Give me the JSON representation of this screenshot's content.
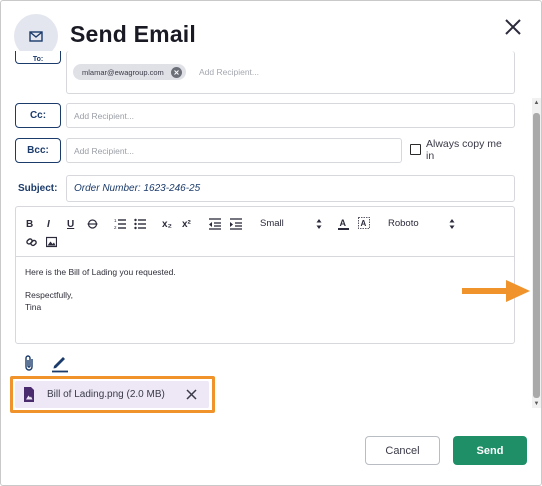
{
  "header": {
    "title": "Send Email",
    "icon": "mail-icon",
    "close_icon": "close-icon"
  },
  "to": {
    "label": "To:",
    "chips": [
      {
        "email": "mlamar@ewagroup.com"
      }
    ],
    "placeholder": "Add Recipient..."
  },
  "cc": {
    "label": "Cc:",
    "placeholder": "Add Recipient..."
  },
  "bcc": {
    "label": "Bcc:",
    "placeholder": "Add Recipient..."
  },
  "always_copy": {
    "label": "Always copy me in",
    "checked": false
  },
  "subject": {
    "label": "Subject:",
    "value": "Order Number: 1623-246-25"
  },
  "toolbar": {
    "bold": "B",
    "italic": "I",
    "underline": "U",
    "font_size": "Small",
    "font_family": "Roboto",
    "subscript": "x₂",
    "superscript": "x²"
  },
  "body": {
    "line1": "Here is the Bill of Lading you requested.",
    "line2": "Respectfully,",
    "line3": "Tina"
  },
  "attachment": {
    "name": "Bill of Lading.png (2.0 MB)"
  },
  "footer": {
    "cancel": "Cancel",
    "send": "Send"
  },
  "colors": {
    "primary": "#1b3b6b",
    "send": "#1f8f68",
    "highlight": "#f0932b",
    "chip_bg": "#eee8f6"
  }
}
